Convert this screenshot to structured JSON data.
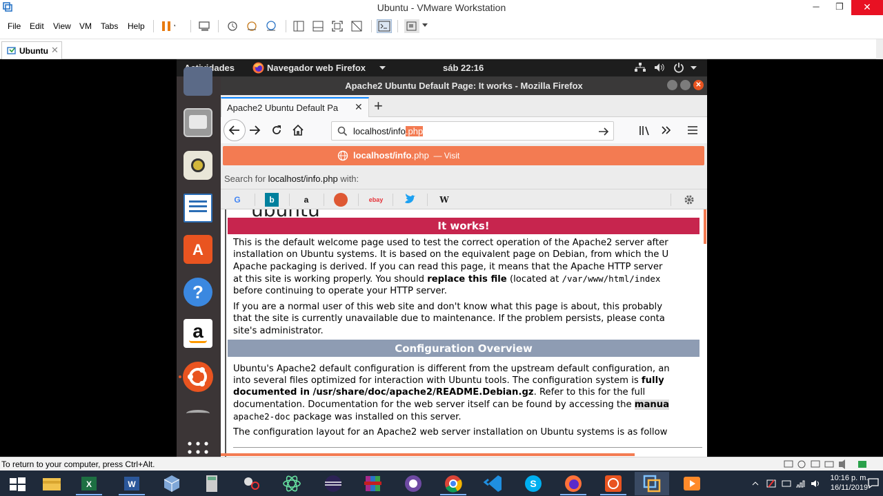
{
  "vmware": {
    "title": "Ubuntu - VMware Workstation",
    "menu": {
      "file": "File",
      "edit": "Edit",
      "view": "View",
      "vm": "VM",
      "tabs": "Tabs",
      "help": "Help"
    },
    "tab_label": "Ubuntu",
    "status_text": "To return to your computer, press Ctrl+Alt."
  },
  "ubuntu": {
    "activities": "Actividades",
    "app_menu": "Navegador web Firefox",
    "clock": "sáb 22:16"
  },
  "firefox": {
    "window_title": "Apache2 Ubuntu Default Page: It works - Mozilla Firefox",
    "tab_title": "Apache2 Ubuntu Default Pa",
    "url_typed": "localhost/info",
    "url_selected": ".php",
    "suggest_bold": "localhost/info",
    "suggest_rest": ".php",
    "suggest_visit": "— Visit",
    "search_for_label": "Search for",
    "search_for_query": "localhost/info.php",
    "search_for_suffix": "with:",
    "engines": {
      "google": "G",
      "bing": "b",
      "amazon": "a",
      "ebay": "ebay",
      "wikipedia": "W"
    }
  },
  "page": {
    "logo_text": "ubuntu",
    "banner": "It works!",
    "p1": {
      "l1": "This is the default welcome page used to test the correct operation of the Apache2 server after",
      "l2": "installation on Ubuntu systems. It is based on the equivalent page on Debian, from which the U",
      "l3": "Apache packaging is derived. If you can read this page, it means that the Apache HTTP server",
      "l4a": "at this site is working properly. You should ",
      "l4b": "replace this file",
      "l4c": " (located at ",
      "l4d": "/var/www/html/index",
      "l5": "before continuing to operate your HTTP server."
    },
    "p2": {
      "l1": "If you are a normal user of this web site and don't know what this page is about, this probably",
      "l2": "that the site is currently unavailable due to maintenance. If the problem persists, please conta",
      "l3": "site's administrator."
    },
    "section": "Configuration Overview",
    "p3": {
      "l1": "Ubuntu's Apache2 default configuration is different from the upstream default configuration, an",
      "l2a": "into several files optimized for interaction with Ubuntu tools. The configuration system is ",
      "l2b": "fully",
      "l3a": "documented in /usr/share/doc/apache2/README.Debian.gz",
      "l3b": ". Refer to this for the full",
      "l4a": "documentation. Documentation for the web server itself can be found by accessing the ",
      "l4b": "manua",
      "l5a": "apache2-doc",
      "l5b": " package was installed on this server."
    },
    "p4": "The configuration layout for an Apache2 web server installation on Ubuntu systems is as follow"
  },
  "taskbar": {
    "clock_time": "10:16 p. m.",
    "clock_date": "16/11/2019"
  },
  "colors": {
    "ubuntu_orange": "#e95420",
    "apache_banner": "#c7254e",
    "section_bar": "#8e9cb3",
    "suggest_bg": "#f37b52",
    "taskbar": "#1f2a3a"
  }
}
